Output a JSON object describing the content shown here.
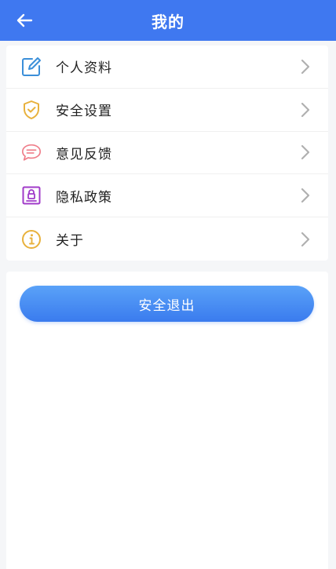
{
  "header": {
    "title": "我的",
    "bg_color": "#3f78f0"
  },
  "menu": {
    "items": [
      {
        "label": "个人资料",
        "icon": "edit-profile-icon",
        "icon_color": "#3b8fd9"
      },
      {
        "label": "安全设置",
        "icon": "shield-check-icon",
        "icon_color": "#e8b13c"
      },
      {
        "label": "意见反馈",
        "icon": "chat-bubble-icon",
        "icon_color": "#ef7e8a"
      },
      {
        "label": "隐私政策",
        "icon": "privacy-lock-icon",
        "icon_color": "#a03bc9"
      },
      {
        "label": "关于",
        "icon": "info-circle-icon",
        "icon_color": "#e8b13c"
      }
    ]
  },
  "logout": {
    "label": "安全退出",
    "color": "#3f80f0"
  }
}
